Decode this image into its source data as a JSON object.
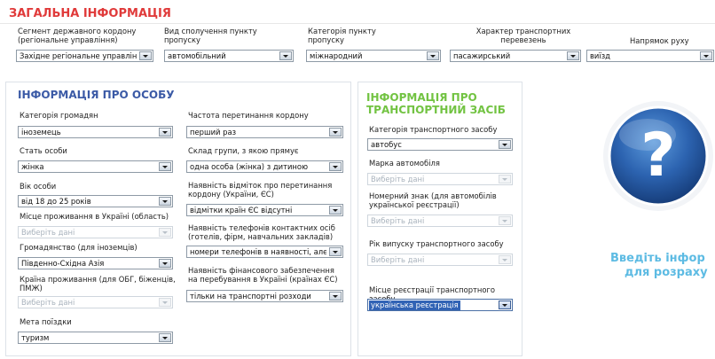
{
  "general": {
    "title": "ЗАГАЛЬНА ІНФОРМАЦІЯ",
    "segment": {
      "label": "Сегмент державного кордону (регіональне управління)",
      "value": "Західне регіональне управлінн"
    },
    "connection": {
      "label": "Вид сполучення пункту пропуску",
      "value": "автомобільний"
    },
    "category": {
      "label": "Категорія пункту пропуску",
      "value": "міжнародний"
    },
    "transport": {
      "label": "Характер транспортних перевезень",
      "value": "пасажирський"
    },
    "direction": {
      "label": "Напрямок руху",
      "value": "виїзд"
    }
  },
  "person": {
    "title": "ІНФОРМАЦІЯ ПРО ОСОБУ",
    "citizen_category": {
      "label": "Категорія громадян",
      "value": "іноземець"
    },
    "sex": {
      "label": "Стать особи",
      "value": "жінка"
    },
    "age": {
      "label": "Вік особи",
      "value": "від 18 до 25 років"
    },
    "residence_region": {
      "label": "Місце проживання в Україні (область)",
      "value": "Виберіть дані"
    },
    "citizenship": {
      "label": "Громадянство (для іноземців)",
      "value": "Південно-Східна Азія"
    },
    "residence_country": {
      "label": "Країна проживання (для ОБГ, біженців, ПМЖ)",
      "value": "Виберіть дані"
    },
    "purpose": {
      "label": "Мета поїздки",
      "value": "туризм"
    },
    "frequency": {
      "label": "Частота перетинання кордону",
      "value": "перший раз"
    },
    "group": {
      "label": "Склад групи, з якою прямує",
      "value": "одна особа (жінка) з дитиною"
    },
    "stamps": {
      "label": "Наявність відміток про перетинання кордону (України, ЄС)",
      "value": "відмітки країн ЄС відсутні"
    },
    "phones": {
      "label": "Наявність телефонів контактних осіб (готелів, фірм, навчальних закладів)",
      "value": "номери телефонів в наявності, але не"
    },
    "finance": {
      "label": "Наявність фінансового забезпечення на перебування в Україні (країнах ЄС)",
      "value": "тільки на транспортні розходи"
    }
  },
  "vehicle": {
    "title_line1": "ІНФОРМАЦІЯ ПРО",
    "title_line2": "ТРАНСПОРТНИЙ ЗАСІБ",
    "category": {
      "label": "Категорія транспортного засобу",
      "value": "автобус"
    },
    "brand": {
      "label": "Марка автомобіля",
      "value": "Виберіть дані"
    },
    "plate": {
      "label": "Номерний знак (для автомобілів української реєстрації)",
      "value": "Виберіть дані"
    },
    "year": {
      "label": "Рік випуску транспортного засобу",
      "value": "Виберіть дані"
    },
    "registration": {
      "label": "Місце реєстрації транспортного засобу",
      "value": "українська реєстрація"
    }
  },
  "result": {
    "icon_glyph": "?",
    "hint_line1": "Введіть інфор",
    "hint_line2": "для розраху"
  },
  "colors": {
    "title_red": "#e03a3a",
    "title_blue": "#3b5aa6",
    "title_green": "#72c342",
    "hint_blue": "#5dbbe3",
    "selected_bg": "#3163b5"
  }
}
